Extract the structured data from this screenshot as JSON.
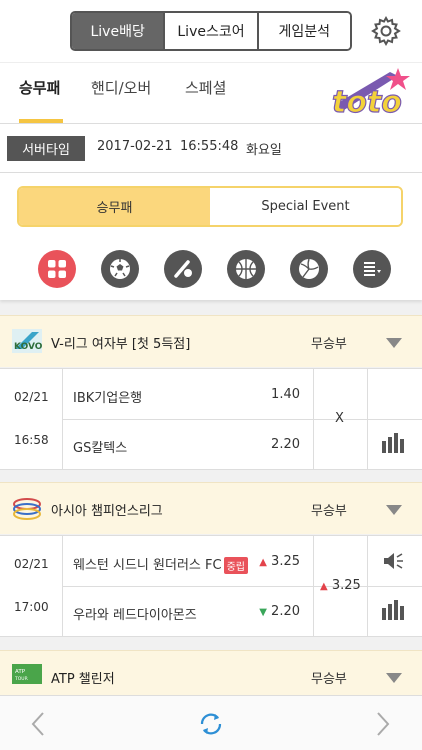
{
  "top_segment": {
    "items": [
      "Live배당",
      "Live스코어",
      "게임분석"
    ],
    "active": 0
  },
  "tabs": {
    "items": [
      "승무패",
      "핸디/오버",
      "스페셜"
    ],
    "active": 0
  },
  "logo": {
    "text": "toto"
  },
  "server_time": {
    "label": "서버타임",
    "date": "2017-02-21",
    "time": "16:55:48",
    "weekday": "화요일"
  },
  "type_toggle": {
    "items": [
      "승무패",
      "Special Event"
    ],
    "active": 0
  },
  "sports": [
    {
      "icon": "all-grid-icon",
      "active": true
    },
    {
      "icon": "soccer-ball-icon",
      "active": false
    },
    {
      "icon": "baseball-icon",
      "active": false
    },
    {
      "icon": "basketball-icon",
      "active": false
    },
    {
      "icon": "volleyball-icon",
      "active": false
    },
    {
      "icon": "more-list-icon",
      "active": false
    }
  ],
  "leagues": [
    {
      "name": "V-리그 여자부 [첫 5득점]",
      "logo_icon": "kovo-logo-icon",
      "type": "무승부",
      "match": {
        "date": "02/21",
        "time": "16:58",
        "home": "IBK기업은행",
        "home_odds": "1.40",
        "away": "GS칼텍스",
        "away_odds": "2.20",
        "draw": "X"
      }
    },
    {
      "name": "아시아 챔피언스리그",
      "logo_icon": "afc-logo-icon",
      "type": "무승부",
      "match": {
        "date": "02/21",
        "time": "17:00",
        "home": "웨스턴 시드니 원더러스 FC",
        "home_badge": "중립",
        "home_odds": "3.25",
        "away": "우라와 레드다이아몬즈",
        "away_odds": "2.20",
        "draw": "3.25"
      }
    },
    {
      "name": "ATP 챌린저",
      "logo_icon": "atp-challenger-logo-icon",
      "type": "무승부"
    }
  ],
  "colors": {
    "accent_yellow": "#f5c542",
    "active_red": "#e9525a",
    "league_bg": "#fdf6e1",
    "up_red": "#e3434b",
    "down_green": "#3aa65a"
  }
}
